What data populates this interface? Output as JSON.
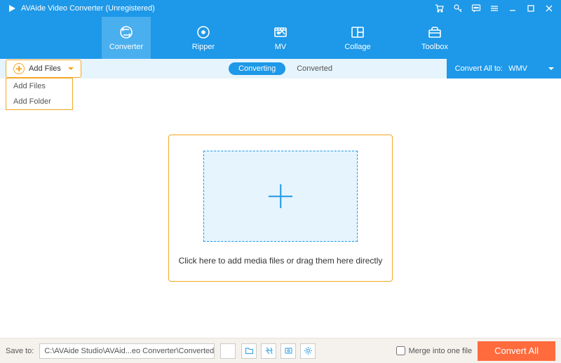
{
  "titlebar": {
    "title": "AVAide Video Converter (Unregistered)"
  },
  "nav": {
    "items": [
      {
        "label": "Converter"
      },
      {
        "label": "Ripper"
      },
      {
        "label": "MV"
      },
      {
        "label": "Collage"
      },
      {
        "label": "Toolbox"
      }
    ]
  },
  "subbar": {
    "add_files": "Add Files",
    "dropdown": {
      "add_files": "Add Files",
      "add_folder": "Add Folder"
    },
    "tab_converting": "Converting",
    "tab_converted": "Converted",
    "convert_all_to": "Convert All to:",
    "format": "WMV"
  },
  "main": {
    "drop_text": "Click here to add media files or drag them here directly"
  },
  "footer": {
    "save_to_label": "Save to:",
    "save_path": "C:\\AVAide Studio\\AVAid...eo Converter\\Converted",
    "merge_label": "Merge into one file",
    "convert_all": "Convert All"
  }
}
